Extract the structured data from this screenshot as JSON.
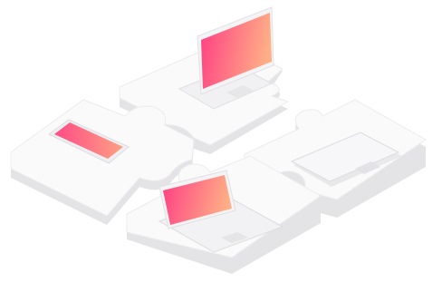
{
  "illustration": {
    "pieces": [
      {
        "name": "puzzle-piece-top",
        "device": "laptop"
      },
      {
        "name": "puzzle-piece-left",
        "device": "smartphone"
      },
      {
        "name": "puzzle-piece-right",
        "device": "closed-laptop"
      },
      {
        "name": "puzzle-piece-bottom",
        "device": "laptop"
      }
    ],
    "colors": {
      "background": "#ffffff",
      "piece_top": "#fafafa",
      "piece_side": "#e4e4e7",
      "piece_shadow": "#d6d6da",
      "screen_gradient_start": "#ff3d84",
      "screen_gradient_end": "#ffae86"
    }
  }
}
